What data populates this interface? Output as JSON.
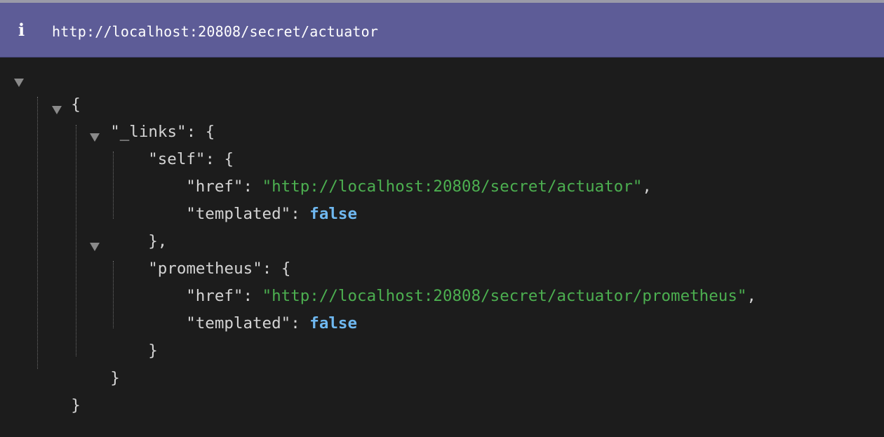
{
  "header": {
    "info_icon": "i",
    "url": "http://localhost:20808/secret/actuator"
  },
  "json": {
    "root_open": "{",
    "root_close": "}",
    "links_key": "\"_links\"",
    "self_key": "\"self\"",
    "prometheus_key": "\"prometheus\"",
    "href_key": "\"href\"",
    "templated_key": "\"templated\"",
    "self_href": "\"http://localhost:20808/secret/actuator\"",
    "self_templated": "false",
    "prometheus_href": "\"http://localhost:20808/secret/actuator/prometheus\"",
    "prometheus_templated": "false",
    "colon_open": ": {",
    "colon": ": ",
    "comma": ",",
    "close_comma": "},",
    "close": "}"
  },
  "colors": {
    "header_bg": "#5d5c97",
    "viewer_bg": "#1c1c1c",
    "string": "#4caf50",
    "boolean": "#6fb8f0"
  }
}
